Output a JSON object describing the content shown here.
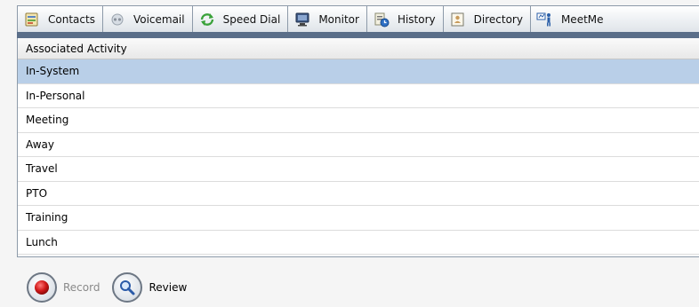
{
  "tabs": [
    {
      "label": "Contacts",
      "icon": "contacts-icon"
    },
    {
      "label": "Voicemail",
      "icon": "voicemail-icon"
    },
    {
      "label": "Speed Dial",
      "icon": "speed-dial-icon"
    },
    {
      "label": "Monitor",
      "icon": "monitor-icon"
    },
    {
      "label": "History",
      "icon": "history-icon"
    },
    {
      "label": "Directory",
      "icon": "directory-icon"
    },
    {
      "label": "MeetMe",
      "icon": "meetme-icon"
    }
  ],
  "list": {
    "header": "Associated Activity",
    "items": [
      {
        "label": "In-System",
        "selected": true
      },
      {
        "label": "In-Personal"
      },
      {
        "label": "Meeting"
      },
      {
        "label": "Away"
      },
      {
        "label": "Travel"
      },
      {
        "label": "PTO"
      },
      {
        "label": "Training"
      },
      {
        "label": "Lunch"
      }
    ]
  },
  "footer": {
    "record_label": "Record",
    "review_label": "Review"
  },
  "colors": {
    "accent_strip": "#5a6e89",
    "selected_row": "#b9cfe8",
    "record_red": "#d01818"
  }
}
